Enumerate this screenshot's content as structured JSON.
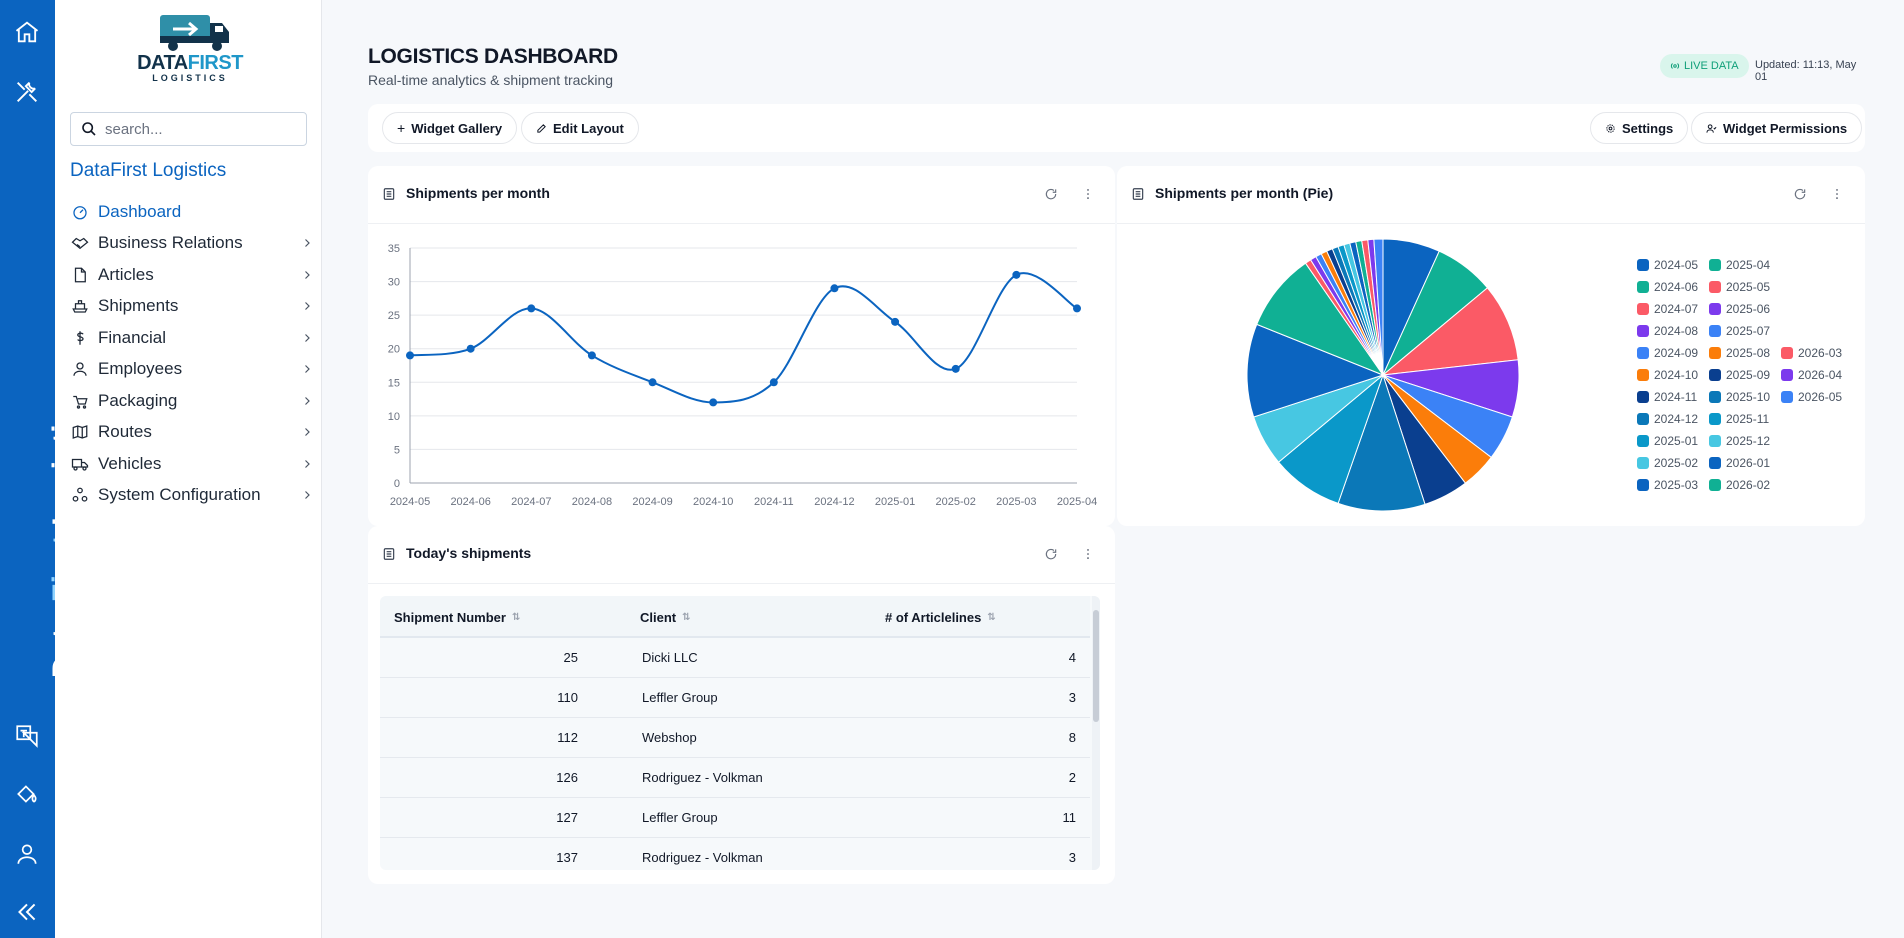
{
  "rail": {
    "brand_a": "Data ",
    "brand_b": "First",
    "brand_c": " Logistics"
  },
  "logo": {
    "name_a": "DATA",
    "name_b": "FIRST",
    "sub": "LOGISTICS"
  },
  "search": {
    "placeholder": "search..."
  },
  "company_name": "DataFirst Logistics",
  "nav": [
    {
      "label": "Dashboard",
      "icon": "dashboard-icon",
      "active": true
    },
    {
      "label": "Business Relations",
      "icon": "handshake-icon"
    },
    {
      "label": "Articles",
      "icon": "file-icon"
    },
    {
      "label": "Shipments",
      "icon": "ship-icon"
    },
    {
      "label": "Financial",
      "icon": "dollar-icon"
    },
    {
      "label": "Employees",
      "icon": "person-icon"
    },
    {
      "label": "Packaging",
      "icon": "package-icon"
    },
    {
      "label": "Routes",
      "icon": "map-icon"
    },
    {
      "label": "Vehicles",
      "icon": "truck-icon"
    },
    {
      "label": "System Configuration",
      "icon": "config-icon"
    }
  ],
  "header": {
    "title": "LOGISTICS DASHBOARD",
    "subtitle": "Real-time analytics & shipment tracking",
    "live_badge": "LIVE DATA",
    "updated": "Updated: 11:13, May 01"
  },
  "toolbar": {
    "widget_gallery": "Widget Gallery",
    "edit_layout": "Edit Layout",
    "settings": "Settings",
    "widget_permissions": "Widget Permissions"
  },
  "widgets": {
    "line_title": "Shipments per month",
    "pie_title": "Shipments per month (Pie)",
    "table_title": "Today's shipments"
  },
  "chart_data": [
    {
      "type": "line",
      "title": "Shipments per month",
      "categories": [
        "2024-05",
        "2024-06",
        "2024-07",
        "2024-08",
        "2024-09",
        "2024-10",
        "2024-11",
        "2024-12",
        "2025-01",
        "2025-02",
        "2025-03",
        "2025-04"
      ],
      "values": [
        19,
        20,
        26,
        19,
        15,
        12,
        15,
        29,
        24,
        17,
        31,
        26
      ],
      "ylim": [
        0,
        35
      ],
      "yticks": [
        0,
        5,
        10,
        15,
        20,
        25,
        30,
        35
      ],
      "grid": true,
      "color": "#0b64c0"
    },
    {
      "type": "pie",
      "title": "Shipments per month (Pie)",
      "legend_position": "right",
      "slices": [
        {
          "label": "2024-05",
          "value": 19,
          "color": "#0b64c0"
        },
        {
          "label": "2024-06",
          "value": 20,
          "color": "#10b094"
        },
        {
          "label": "2024-07",
          "value": 26,
          "color": "#fb5a66"
        },
        {
          "label": "2024-08",
          "value": 19,
          "color": "#7c3aed"
        },
        {
          "label": "2024-09",
          "value": 15,
          "color": "#3b82f6"
        },
        {
          "label": "2024-10",
          "value": 12,
          "color": "#fb7d0a"
        },
        {
          "label": "2024-11",
          "value": 15,
          "color": "#0a3f8f"
        },
        {
          "label": "2024-12",
          "value": 29,
          "color": "#0b78b8"
        },
        {
          "label": "2025-01",
          "value": 24,
          "color": "#0a98c9"
        },
        {
          "label": "2025-02",
          "value": 17,
          "color": "#47c7e2"
        },
        {
          "label": "2025-03",
          "value": 31,
          "color": "#0b64c0"
        },
        {
          "label": "2025-04",
          "value": 26,
          "color": "#10b094"
        },
        {
          "label": "2025-05",
          "value": 2,
          "color": "#fb5a66"
        },
        {
          "label": "2025-06",
          "value": 2,
          "color": "#7c3aed"
        },
        {
          "label": "2025-07",
          "value": 2,
          "color": "#3b82f6"
        },
        {
          "label": "2025-08",
          "value": 2,
          "color": "#fb7d0a"
        },
        {
          "label": "2025-09",
          "value": 2,
          "color": "#0a3f8f"
        },
        {
          "label": "2025-10",
          "value": 2,
          "color": "#0b78b8"
        },
        {
          "label": "2025-11",
          "value": 2,
          "color": "#0a98c9"
        },
        {
          "label": "2025-12",
          "value": 2,
          "color": "#47c7e2"
        },
        {
          "label": "2026-01",
          "value": 2,
          "color": "#0b64c0"
        },
        {
          "label": "2026-02",
          "value": 2,
          "color": "#10b094"
        },
        {
          "label": "2026-03",
          "value": 2,
          "color": "#fb5a66"
        },
        {
          "label": "2026-04",
          "value": 2,
          "color": "#7c3aed"
        },
        {
          "label": "2026-05",
          "value": 3,
          "color": "#3b82f6"
        }
      ]
    }
  ],
  "table": {
    "columns": [
      "Shipment Number",
      "Client",
      "# of Articlelines"
    ],
    "rows": [
      {
        "number": "25",
        "client": "Dicki LLC",
        "lines": "4"
      },
      {
        "number": "110",
        "client": "Leffler Group",
        "lines": "3"
      },
      {
        "number": "112",
        "client": "Webshop",
        "lines": "8"
      },
      {
        "number": "126",
        "client": "Rodriguez - Volkman",
        "lines": "2"
      },
      {
        "number": "127",
        "client": "Leffler Group",
        "lines": "11"
      },
      {
        "number": "137",
        "client": "Rodriguez - Volkman",
        "lines": "3"
      }
    ]
  }
}
